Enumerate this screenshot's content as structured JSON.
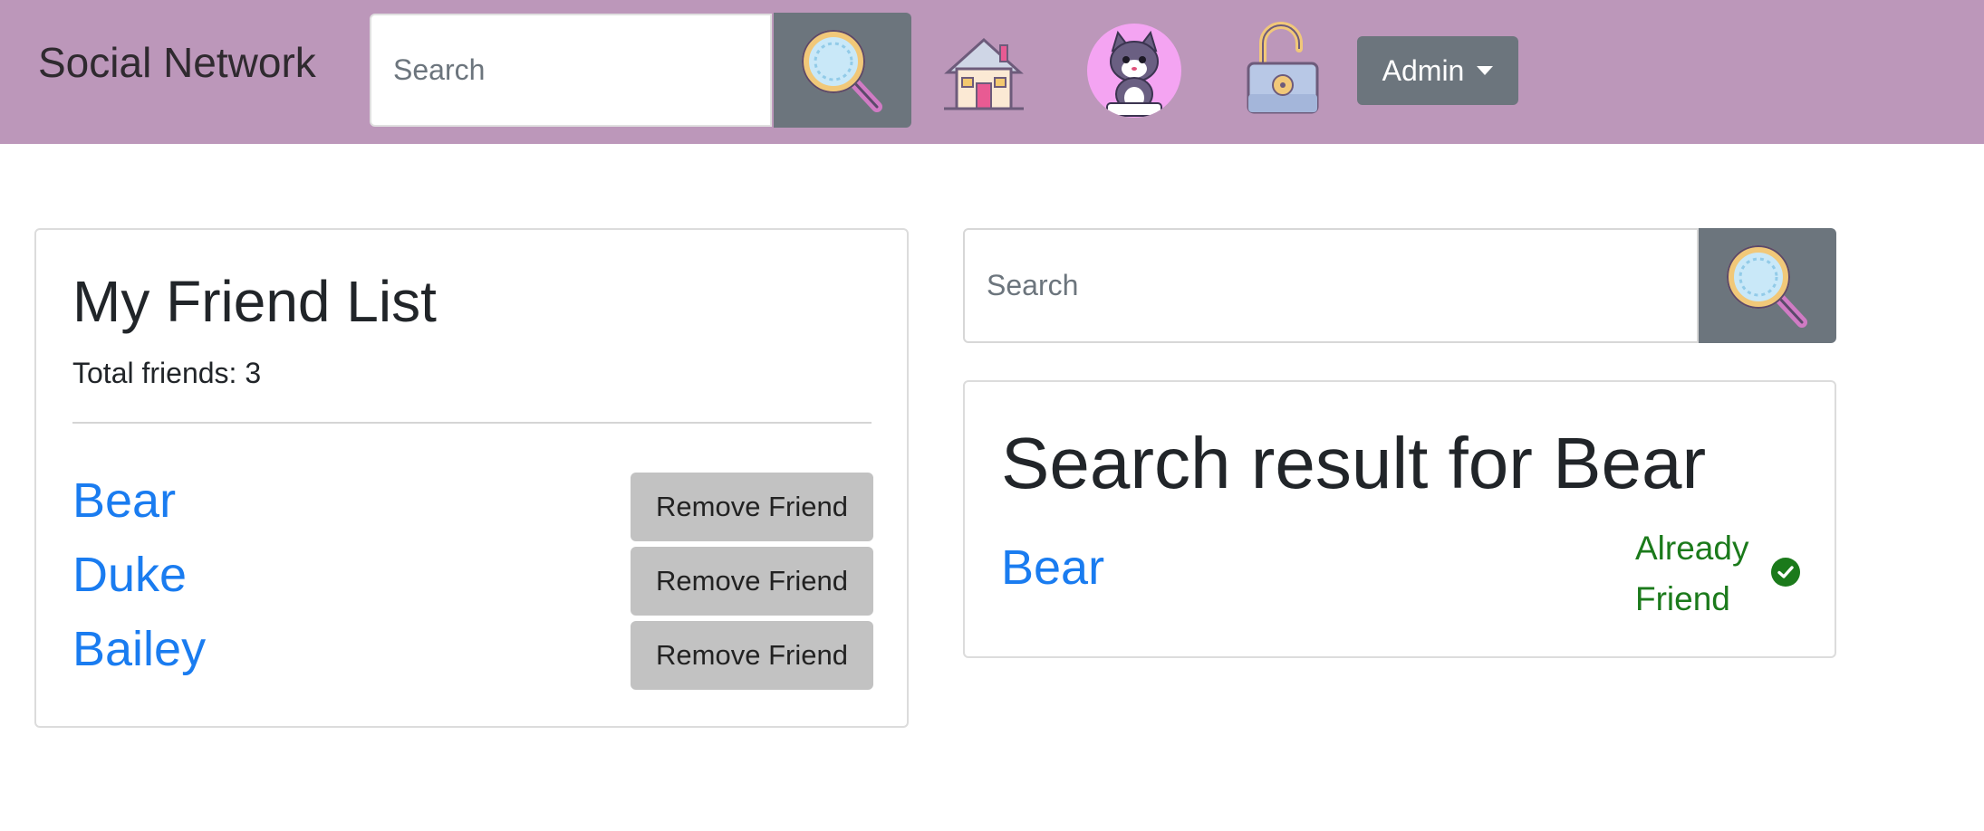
{
  "navbar": {
    "brand": "Social Network",
    "search_placeholder": "Search",
    "admin_label": "Admin",
    "icons": [
      "search-icon",
      "home-icon",
      "cat-avatar",
      "unlock-icon",
      "chevron-down-icon"
    ]
  },
  "friend_list": {
    "title": "My Friend List",
    "total": "Total friends: 3",
    "remove_label": "Remove Friend",
    "friends": [
      {
        "name": "Bear"
      },
      {
        "name": "Duke"
      },
      {
        "name": "Bailey"
      }
    ]
  },
  "search_panel": {
    "placeholder": "Search",
    "result_title": "Search result for Bear",
    "result_name": "Bear",
    "status": "Already Friend",
    "status_icon": "check-circle-icon"
  },
  "colors": {
    "navbar": "#bc97ba",
    "button_gray": "#6c757d",
    "link": "#1a7cf0",
    "friend_status": "#1b7a1b",
    "remove_button": "#c2c2c2"
  }
}
